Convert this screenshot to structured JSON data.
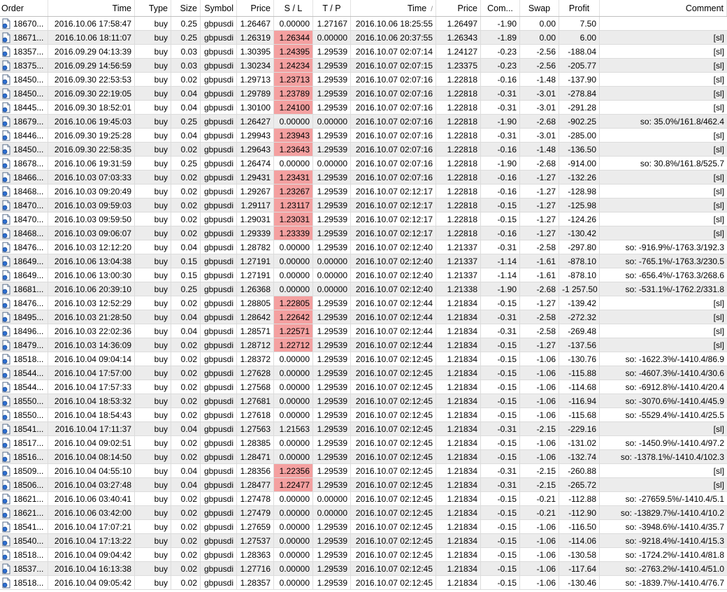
{
  "headers": {
    "order": "Order",
    "time": "Time",
    "type": "Type",
    "size": "Size",
    "symbol": "Symbol",
    "price": "Price",
    "sl": "S / L",
    "tp": "T / P",
    "close_time": "Time",
    "close_time_sort": "/",
    "close_price": "Price",
    "commission": "Com...",
    "swap": "Swap",
    "profit": "Profit",
    "comment": "Comment"
  },
  "colors": {
    "sl_highlight": "#f4a0a0",
    "alt_row": "#ececec"
  },
  "icons": {
    "row_icon": "document-trade-icon"
  },
  "rows": [
    {
      "order": "18670...",
      "time": "2016.10.06 17:58:47",
      "type": "buy",
      "size": "0.25",
      "symbol": "gbpusdi",
      "price": "1.26467",
      "sl": "0.00000",
      "sl_hit": false,
      "tp": "1.27167",
      "close_time": "2016.10.06 18:25:55",
      "close_price": "1.26497",
      "commission": "-1.90",
      "swap": "0.00",
      "profit": "7.50",
      "comment": ""
    },
    {
      "order": "18671...",
      "time": "2016.10.06 18:11:07",
      "type": "buy",
      "size": "0.25",
      "symbol": "gbpusdi",
      "price": "1.26319",
      "sl": "1.26344",
      "sl_hit": true,
      "tp": "0.00000",
      "close_time": "2016.10.06 20:37:55",
      "close_price": "1.26343",
      "commission": "-1.89",
      "swap": "0.00",
      "profit": "6.00",
      "comment": "[sl]"
    },
    {
      "order": "18357...",
      "time": "2016.09.29 04:13:39",
      "type": "buy",
      "size": "0.03",
      "symbol": "gbpusdi",
      "price": "1.30395",
      "sl": "1.24395",
      "sl_hit": true,
      "tp": "1.29539",
      "close_time": "2016.10.07 02:07:14",
      "close_price": "1.24127",
      "commission": "-0.23",
      "swap": "-2.56",
      "profit": "-188.04",
      "comment": "[sl]"
    },
    {
      "order": "18375...",
      "time": "2016.09.29 14:56:59",
      "type": "buy",
      "size": "0.03",
      "symbol": "gbpusdi",
      "price": "1.30234",
      "sl": "1.24234",
      "sl_hit": true,
      "tp": "1.29539",
      "close_time": "2016.10.07 02:07:15",
      "close_price": "1.23375",
      "commission": "-0.23",
      "swap": "-2.56",
      "profit": "-205.77",
      "comment": "[sl]"
    },
    {
      "order": "18450...",
      "time": "2016.09.30 22:53:53",
      "type": "buy",
      "size": "0.02",
      "symbol": "gbpusdi",
      "price": "1.29713",
      "sl": "1.23713",
      "sl_hit": true,
      "tp": "1.29539",
      "close_time": "2016.10.07 02:07:16",
      "close_price": "1.22818",
      "commission": "-0.16",
      "swap": "-1.48",
      "profit": "-137.90",
      "comment": "[sl]"
    },
    {
      "order": "18450...",
      "time": "2016.09.30 22:19:05",
      "type": "buy",
      "size": "0.04",
      "symbol": "gbpusdi",
      "price": "1.29789",
      "sl": "1.23789",
      "sl_hit": true,
      "tp": "1.29539",
      "close_time": "2016.10.07 02:07:16",
      "close_price": "1.22818",
      "commission": "-0.31",
      "swap": "-3.01",
      "profit": "-278.84",
      "comment": "[sl]"
    },
    {
      "order": "18445...",
      "time": "2016.09.30 18:52:01",
      "type": "buy",
      "size": "0.04",
      "symbol": "gbpusdi",
      "price": "1.30100",
      "sl": "1.24100",
      "sl_hit": true,
      "tp": "1.29539",
      "close_time": "2016.10.07 02:07:16",
      "close_price": "1.22818",
      "commission": "-0.31",
      "swap": "-3.01",
      "profit": "-291.28",
      "comment": "[sl]"
    },
    {
      "order": "18679...",
      "time": "2016.10.06 19:45:03",
      "type": "buy",
      "size": "0.25",
      "symbol": "gbpusdi",
      "price": "1.26427",
      "sl": "0.00000",
      "sl_hit": false,
      "tp": "0.00000",
      "close_time": "2016.10.07 02:07:16",
      "close_price": "1.22818",
      "commission": "-1.90",
      "swap": "-2.68",
      "profit": "-902.25",
      "comment": "so: 35.0%/161.8/462.4"
    },
    {
      "order": "18446...",
      "time": "2016.09.30 19:25:28",
      "type": "buy",
      "size": "0.04",
      "symbol": "gbpusdi",
      "price": "1.29943",
      "sl": "1.23943",
      "sl_hit": true,
      "tp": "1.29539",
      "close_time": "2016.10.07 02:07:16",
      "close_price": "1.22818",
      "commission": "-0.31",
      "swap": "-3.01",
      "profit": "-285.00",
      "comment": "[sl]"
    },
    {
      "order": "18450...",
      "time": "2016.09.30 22:58:35",
      "type": "buy",
      "size": "0.02",
      "symbol": "gbpusdi",
      "price": "1.29643",
      "sl": "1.23643",
      "sl_hit": true,
      "tp": "1.29539",
      "close_time": "2016.10.07 02:07:16",
      "close_price": "1.22818",
      "commission": "-0.16",
      "swap": "-1.48",
      "profit": "-136.50",
      "comment": "[sl]"
    },
    {
      "order": "18678...",
      "time": "2016.10.06 19:31:59",
      "type": "buy",
      "size": "0.25",
      "symbol": "gbpusdi",
      "price": "1.26474",
      "sl": "0.00000",
      "sl_hit": false,
      "tp": "0.00000",
      "close_time": "2016.10.07 02:07:16",
      "close_price": "1.22818",
      "commission": "-1.90",
      "swap": "-2.68",
      "profit": "-914.00",
      "comment": "so: 30.8%/161.8/525.7"
    },
    {
      "order": "18466...",
      "time": "2016.10.03 07:03:33",
      "type": "buy",
      "size": "0.02",
      "symbol": "gbpusdi",
      "price": "1.29431",
      "sl": "1.23431",
      "sl_hit": true,
      "tp": "1.29539",
      "close_time": "2016.10.07 02:07:16",
      "close_price": "1.22818",
      "commission": "-0.16",
      "swap": "-1.27",
      "profit": "-132.26",
      "comment": "[sl]"
    },
    {
      "order": "18468...",
      "time": "2016.10.03 09:20:49",
      "type": "buy",
      "size": "0.02",
      "symbol": "gbpusdi",
      "price": "1.29267",
      "sl": "1.23267",
      "sl_hit": true,
      "tp": "1.29539",
      "close_time": "2016.10.07 02:12:17",
      "close_price": "1.22818",
      "commission": "-0.16",
      "swap": "-1.27",
      "profit": "-128.98",
      "comment": "[sl]"
    },
    {
      "order": "18470...",
      "time": "2016.10.03 09:59:03",
      "type": "buy",
      "size": "0.02",
      "symbol": "gbpusdi",
      "price": "1.29117",
      "sl": "1.23117",
      "sl_hit": true,
      "tp": "1.29539",
      "close_time": "2016.10.07 02:12:17",
      "close_price": "1.22818",
      "commission": "-0.15",
      "swap": "-1.27",
      "profit": "-125.98",
      "comment": "[sl]"
    },
    {
      "order": "18470...",
      "time": "2016.10.03 09:59:50",
      "type": "buy",
      "size": "0.02",
      "symbol": "gbpusdi",
      "price": "1.29031",
      "sl": "1.23031",
      "sl_hit": true,
      "tp": "1.29539",
      "close_time": "2016.10.07 02:12:17",
      "close_price": "1.22818",
      "commission": "-0.15",
      "swap": "-1.27",
      "profit": "-124.26",
      "comment": "[sl]"
    },
    {
      "order": "18468...",
      "time": "2016.10.03 09:06:07",
      "type": "buy",
      "size": "0.02",
      "symbol": "gbpusdi",
      "price": "1.29339",
      "sl": "1.23339",
      "sl_hit": true,
      "tp": "1.29539",
      "close_time": "2016.10.07 02:12:17",
      "close_price": "1.22818",
      "commission": "-0.16",
      "swap": "-1.27",
      "profit": "-130.42",
      "comment": "[sl]"
    },
    {
      "order": "18476...",
      "time": "2016.10.03 12:12:20",
      "type": "buy",
      "size": "0.04",
      "symbol": "gbpusdi",
      "price": "1.28782",
      "sl": "0.00000",
      "sl_hit": false,
      "tp": "1.29539",
      "close_time": "2016.10.07 02:12:40",
      "close_price": "1.21337",
      "commission": "-0.31",
      "swap": "-2.58",
      "profit": "-297.80",
      "comment": "so: -916.9%/-1763.3/192.3"
    },
    {
      "order": "18649...",
      "time": "2016.10.06 13:04:38",
      "type": "buy",
      "size": "0.15",
      "symbol": "gbpusdi",
      "price": "1.27191",
      "sl": "0.00000",
      "sl_hit": false,
      "tp": "0.00000",
      "close_time": "2016.10.07 02:12:40",
      "close_price": "1.21337",
      "commission": "-1.14",
      "swap": "-1.61",
      "profit": "-878.10",
      "comment": "so: -765.1%/-1763.3/230.5"
    },
    {
      "order": "18649...",
      "time": "2016.10.06 13:00:30",
      "type": "buy",
      "size": "0.15",
      "symbol": "gbpusdi",
      "price": "1.27191",
      "sl": "0.00000",
      "sl_hit": false,
      "tp": "0.00000",
      "close_time": "2016.10.07 02:12:40",
      "close_price": "1.21337",
      "commission": "-1.14",
      "swap": "-1.61",
      "profit": "-878.10",
      "comment": "so: -656.4%/-1763.3/268.6"
    },
    {
      "order": "18681...",
      "time": "2016.10.06 20:39:10",
      "type": "buy",
      "size": "0.25",
      "symbol": "gbpusdi",
      "price": "1.26368",
      "sl": "0.00000",
      "sl_hit": false,
      "tp": "0.00000",
      "close_time": "2016.10.07 02:12:40",
      "close_price": "1.21338",
      "commission": "-1.90",
      "swap": "-2.68",
      "profit": "-1 257.50",
      "comment": "so: -531.1%/-1762.2/331.8"
    },
    {
      "order": "18476...",
      "time": "2016.10.03 12:52:29",
      "type": "buy",
      "size": "0.02",
      "symbol": "gbpusdi",
      "price": "1.28805",
      "sl": "1.22805",
      "sl_hit": true,
      "tp": "1.29539",
      "close_time": "2016.10.07 02:12:44",
      "close_price": "1.21834",
      "commission": "-0.15",
      "swap": "-1.27",
      "profit": "-139.42",
      "comment": "[sl]"
    },
    {
      "order": "18495...",
      "time": "2016.10.03 21:28:50",
      "type": "buy",
      "size": "0.04",
      "symbol": "gbpusdi",
      "price": "1.28642",
      "sl": "1.22642",
      "sl_hit": true,
      "tp": "1.29539",
      "close_time": "2016.10.07 02:12:44",
      "close_price": "1.21834",
      "commission": "-0.31",
      "swap": "-2.58",
      "profit": "-272.32",
      "comment": "[sl]"
    },
    {
      "order": "18496...",
      "time": "2016.10.03 22:02:36",
      "type": "buy",
      "size": "0.04",
      "symbol": "gbpusdi",
      "price": "1.28571",
      "sl": "1.22571",
      "sl_hit": true,
      "tp": "1.29539",
      "close_time": "2016.10.07 02:12:44",
      "close_price": "1.21834",
      "commission": "-0.31",
      "swap": "-2.58",
      "profit": "-269.48",
      "comment": "[sl]"
    },
    {
      "order": "18479...",
      "time": "2016.10.03 14:36:09",
      "type": "buy",
      "size": "0.02",
      "symbol": "gbpusdi",
      "price": "1.28712",
      "sl": "1.22712",
      "sl_hit": true,
      "tp": "1.29539",
      "close_time": "2016.10.07 02:12:44",
      "close_price": "1.21834",
      "commission": "-0.15",
      "swap": "-1.27",
      "profit": "-137.56",
      "comment": "[sl]"
    },
    {
      "order": "18518...",
      "time": "2016.10.04 09:04:14",
      "type": "buy",
      "size": "0.02",
      "symbol": "gbpusdi",
      "price": "1.28372",
      "sl": "0.00000",
      "sl_hit": false,
      "tp": "1.29539",
      "close_time": "2016.10.07 02:12:45",
      "close_price": "1.21834",
      "commission": "-0.15",
      "swap": "-1.06",
      "profit": "-130.76",
      "comment": "so: -1622.3%/-1410.4/86.9"
    },
    {
      "order": "18544...",
      "time": "2016.10.04 17:57:00",
      "type": "buy",
      "size": "0.02",
      "symbol": "gbpusdi",
      "price": "1.27628",
      "sl": "0.00000",
      "sl_hit": false,
      "tp": "1.29539",
      "close_time": "2016.10.07 02:12:45",
      "close_price": "1.21834",
      "commission": "-0.15",
      "swap": "-1.06",
      "profit": "-115.88",
      "comment": "so: -4607.3%/-1410.4/30.6"
    },
    {
      "order": "18544...",
      "time": "2016.10.04 17:57:33",
      "type": "buy",
      "size": "0.02",
      "symbol": "gbpusdi",
      "price": "1.27568",
      "sl": "0.00000",
      "sl_hit": false,
      "tp": "1.29539",
      "close_time": "2016.10.07 02:12:45",
      "close_price": "1.21834",
      "commission": "-0.15",
      "swap": "-1.06",
      "profit": "-114.68",
      "comment": "so: -6912.8%/-1410.4/20.4"
    },
    {
      "order": "18550...",
      "time": "2016.10.04 18:53:32",
      "type": "buy",
      "size": "0.02",
      "symbol": "gbpusdi",
      "price": "1.27681",
      "sl": "0.00000",
      "sl_hit": false,
      "tp": "1.29539",
      "close_time": "2016.10.07 02:12:45",
      "close_price": "1.21834",
      "commission": "-0.15",
      "swap": "-1.06",
      "profit": "-116.94",
      "comment": "so: -3070.6%/-1410.4/45.9"
    },
    {
      "order": "18550...",
      "time": "2016.10.04 18:54:43",
      "type": "buy",
      "size": "0.02",
      "symbol": "gbpusdi",
      "price": "1.27618",
      "sl": "0.00000",
      "sl_hit": false,
      "tp": "1.29539",
      "close_time": "2016.10.07 02:12:45",
      "close_price": "1.21834",
      "commission": "-0.15",
      "swap": "-1.06",
      "profit": "-115.68",
      "comment": "so: -5529.4%/-1410.4/25.5"
    },
    {
      "order": "18541...",
      "time": "2016.10.04 17:11:37",
      "type": "buy",
      "size": "0.04",
      "symbol": "gbpusdi",
      "price": "1.27563",
      "sl": "1.21563",
      "sl_hit": false,
      "tp": "1.29539",
      "close_time": "2016.10.07 02:12:45",
      "close_price": "1.21834",
      "commission": "-0.31",
      "swap": "-2.15",
      "profit": "-229.16",
      "comment": "[sl]"
    },
    {
      "order": "18517...",
      "time": "2016.10.04 09:02:51",
      "type": "buy",
      "size": "0.02",
      "symbol": "gbpusdi",
      "price": "1.28385",
      "sl": "0.00000",
      "sl_hit": false,
      "tp": "1.29539",
      "close_time": "2016.10.07 02:12:45",
      "close_price": "1.21834",
      "commission": "-0.15",
      "swap": "-1.06",
      "profit": "-131.02",
      "comment": "so: -1450.9%/-1410.4/97.2"
    },
    {
      "order": "18516...",
      "time": "2016.10.04 08:14:50",
      "type": "buy",
      "size": "0.02",
      "symbol": "gbpusdi",
      "price": "1.28471",
      "sl": "0.00000",
      "sl_hit": false,
      "tp": "1.29539",
      "close_time": "2016.10.07 02:12:45",
      "close_price": "1.21834",
      "commission": "-0.15",
      "swap": "-1.06",
      "profit": "-132.74",
      "comment": "so: -1378.1%/-1410.4/102.3"
    },
    {
      "order": "18509...",
      "time": "2016.10.04 04:55:10",
      "type": "buy",
      "size": "0.04",
      "symbol": "gbpusdi",
      "price": "1.28356",
      "sl": "1.22356",
      "sl_hit": true,
      "tp": "1.29539",
      "close_time": "2016.10.07 02:12:45",
      "close_price": "1.21834",
      "commission": "-0.31",
      "swap": "-2.15",
      "profit": "-260.88",
      "comment": "[sl]"
    },
    {
      "order": "18506...",
      "time": "2016.10.04 03:27:48",
      "type": "buy",
      "size": "0.04",
      "symbol": "gbpusdi",
      "price": "1.28477",
      "sl": "1.22477",
      "sl_hit": true,
      "tp": "1.29539",
      "close_time": "2016.10.07 02:12:45",
      "close_price": "1.21834",
      "commission": "-0.31",
      "swap": "-2.15",
      "profit": "-265.72",
      "comment": "[sl]"
    },
    {
      "order": "18621...",
      "time": "2016.10.06 03:40:41",
      "type": "buy",
      "size": "0.02",
      "symbol": "gbpusdi",
      "price": "1.27478",
      "sl": "0.00000",
      "sl_hit": false,
      "tp": "0.00000",
      "close_time": "2016.10.07 02:12:45",
      "close_price": "1.21834",
      "commission": "-0.15",
      "swap": "-0.21",
      "profit": "-112.88",
      "comment": "so: -27659.5%/-1410.4/5.1"
    },
    {
      "order": "18621...",
      "time": "2016.10.06 03:42:00",
      "type": "buy",
      "size": "0.02",
      "symbol": "gbpusdi",
      "price": "1.27479",
      "sl": "0.00000",
      "sl_hit": false,
      "tp": "0.00000",
      "close_time": "2016.10.07 02:12:45",
      "close_price": "1.21834",
      "commission": "-0.15",
      "swap": "-0.21",
      "profit": "-112.90",
      "comment": "so: -13829.7%/-1410.4/10.2"
    },
    {
      "order": "18541...",
      "time": "2016.10.04 17:07:21",
      "type": "buy",
      "size": "0.02",
      "symbol": "gbpusdi",
      "price": "1.27659",
      "sl": "0.00000",
      "sl_hit": false,
      "tp": "1.29539",
      "close_time": "2016.10.07 02:12:45",
      "close_price": "1.21834",
      "commission": "-0.15",
      "swap": "-1.06",
      "profit": "-116.50",
      "comment": "so: -3948.6%/-1410.4/35.7"
    },
    {
      "order": "18540...",
      "time": "2016.10.04 17:13:22",
      "type": "buy",
      "size": "0.02",
      "symbol": "gbpusdi",
      "price": "1.27537",
      "sl": "0.00000",
      "sl_hit": false,
      "tp": "1.29539",
      "close_time": "2016.10.07 02:12:45",
      "close_price": "1.21834",
      "commission": "-0.15",
      "swap": "-1.06",
      "profit": "-114.06",
      "comment": "so: -9218.4%/-1410.4/15.3"
    },
    {
      "order": "18518...",
      "time": "2016.10.04 09:04:42",
      "type": "buy",
      "size": "0.02",
      "symbol": "gbpusdi",
      "price": "1.28363",
      "sl": "0.00000",
      "sl_hit": false,
      "tp": "1.29539",
      "close_time": "2016.10.07 02:12:45",
      "close_price": "1.21834",
      "commission": "-0.15",
      "swap": "-1.06",
      "profit": "-130.58",
      "comment": "so: -1724.2%/-1410.4/81.8"
    },
    {
      "order": "18537...",
      "time": "2016.10.04 16:13:38",
      "type": "buy",
      "size": "0.02",
      "symbol": "gbpusdi",
      "price": "1.27716",
      "sl": "0.00000",
      "sl_hit": false,
      "tp": "1.29539",
      "close_time": "2016.10.07 02:12:45",
      "close_price": "1.21834",
      "commission": "-0.15",
      "swap": "-1.06",
      "profit": "-117.64",
      "comment": "so: -2763.2%/-1410.4/51.0"
    },
    {
      "order": "18518...",
      "time": "2016.10.04 09:05:42",
      "type": "buy",
      "size": "0.02",
      "symbol": "gbpusdi",
      "price": "1.28357",
      "sl": "0.00000",
      "sl_hit": false,
      "tp": "1.29539",
      "close_time": "2016.10.07 02:12:45",
      "close_price": "1.21834",
      "commission": "-0.15",
      "swap": "-1.06",
      "profit": "-130.46",
      "comment": "so: -1839.7%/-1410.4/76.7"
    }
  ]
}
